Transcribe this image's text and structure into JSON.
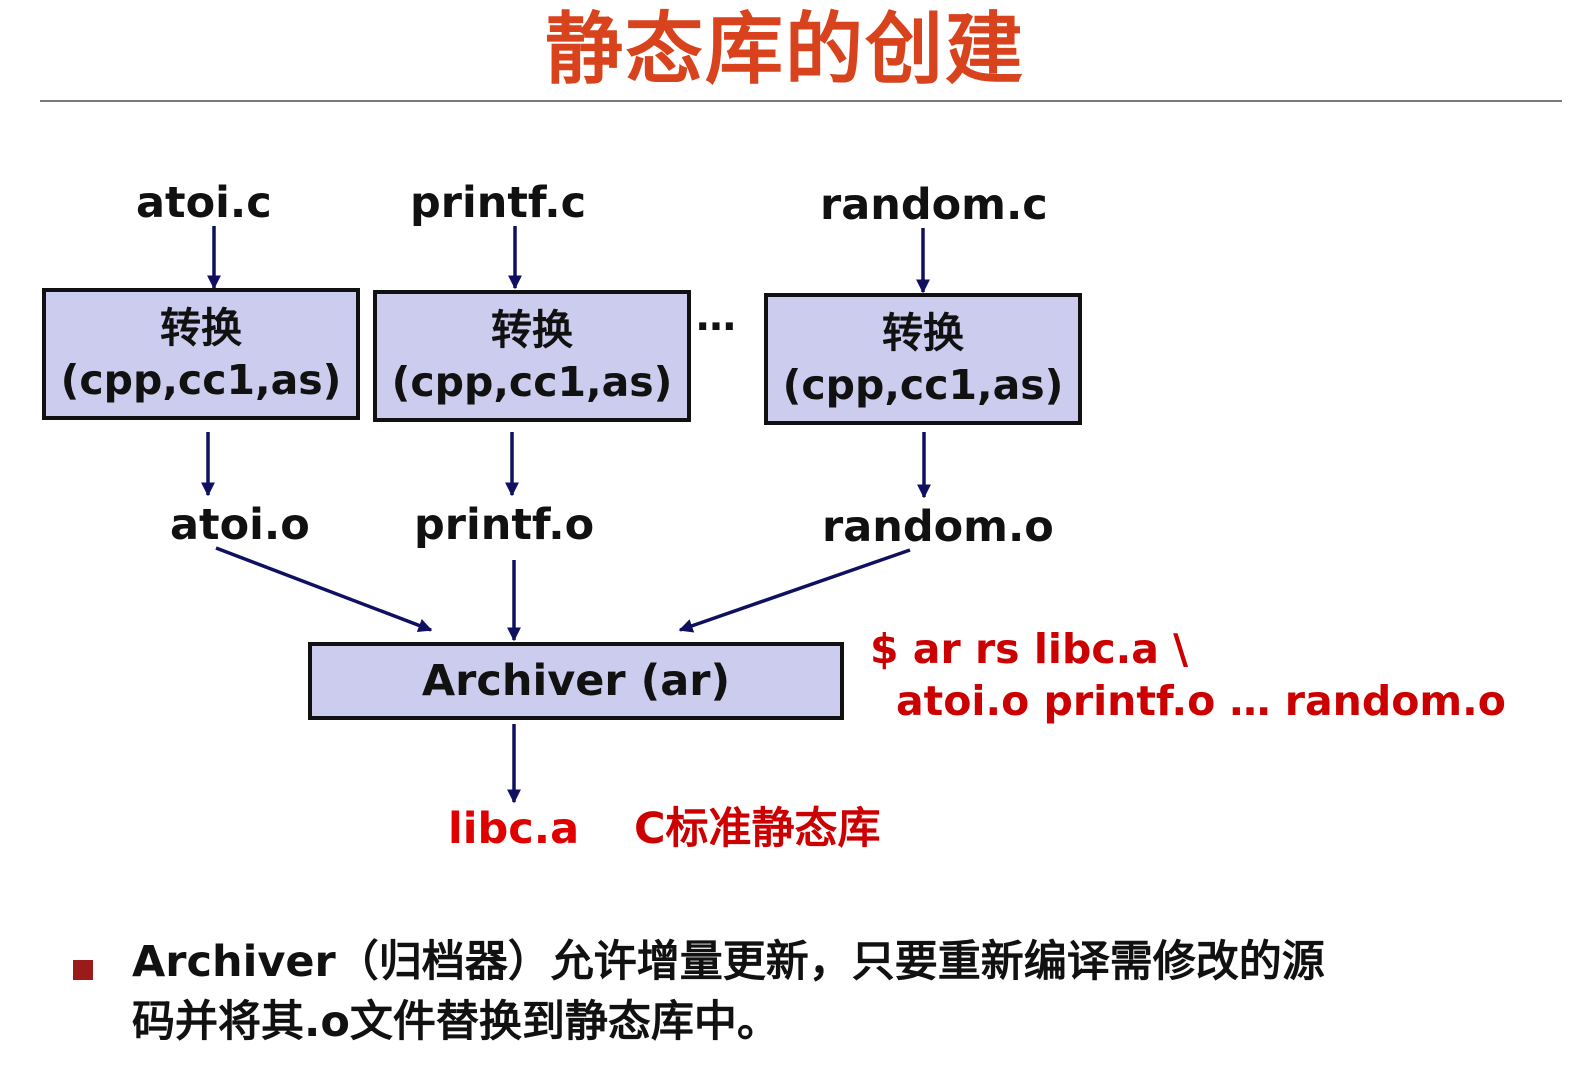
{
  "title": "静态库的创建",
  "diagram": {
    "sources": [
      "atoi.c",
      "printf.c",
      "random.c"
    ],
    "translator": {
      "line1": "转换",
      "line2": "(cpp,cc1,as)"
    },
    "ellipsis": "…",
    "objects": [
      "atoi.o",
      "printf.o",
      "random.o"
    ],
    "archiver": "Archiver (ar)",
    "output": {
      "file": "libc.a",
      "desc": "C标准静态库"
    },
    "command": {
      "line1": "$ ar rs libc.a \\",
      "line2": "atoi.o printf.o … random.o"
    }
  },
  "bullet": {
    "line1": "Archiver（归档器）允许增量更新，只要重新编译需修改的源",
    "line2": "码并将其.o文件替换到静态库中。"
  },
  "colors": {
    "title": "#d8421c",
    "box_fill": "#ccccee",
    "arrow": "#101060",
    "command": "#cc0000",
    "output": "#e00000",
    "bullet": "#9b1b1b"
  }
}
